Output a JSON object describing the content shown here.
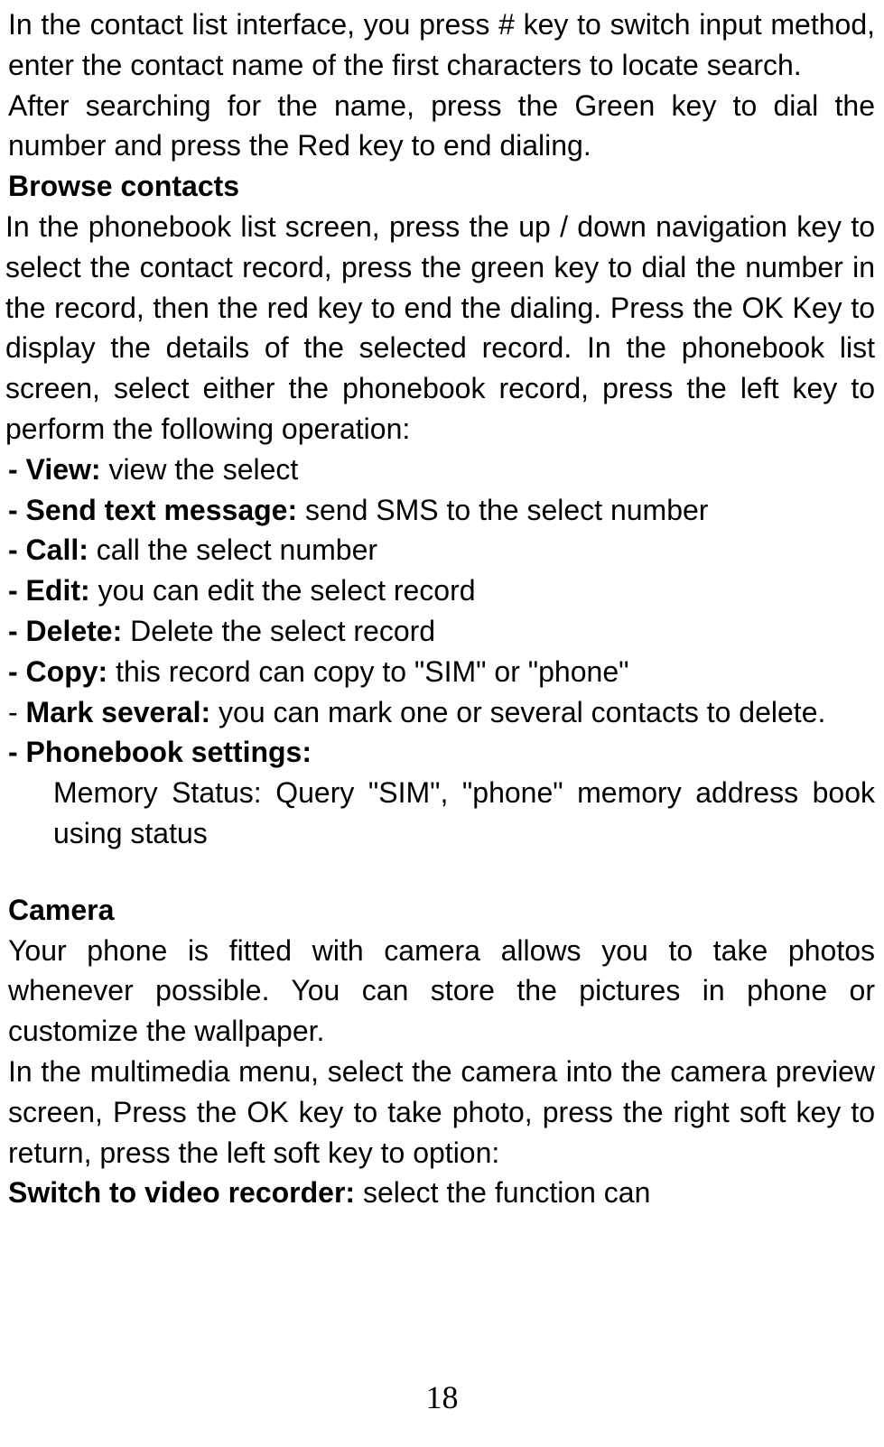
{
  "p1": "In the contact list interface, you press # key to switch input method, enter the contact name of the first characters to locate search.",
  "p2": "After searching for the name, press the Green key to dial the number and press the Red key to end dialing.",
  "h1": "Browse contacts",
  "p3": "In the phonebook list screen, press the up / down navigation key to select the contact record, press the green key to dial the number in the record, then the red key to end the dialing. Press the OK Key to display the details of the selected record. In the phonebook list screen, select either the phonebook record, press the left key to perform the following operation:",
  "item1_label": " - View: ",
  "item1_text": "view the select",
  "item2_label": "- Send text message: ",
  "item2_text": "send SMS to the select number",
  "item3_label": "- Call: ",
  "item3_text": "call the select number",
  "item4_label": "- Edit: ",
  "item4_text": "you can edit the select record",
  "item5_label": "- Delete: ",
  "item5_text": "Delete the select record",
  "item6_label": "- Copy: ",
  "item6_text": "this record can copy to \"SIM\" or \"phone\"",
  "item7_dash": "- ",
  "item7_label": "Mark several: ",
  "item7_text": "you can mark one or several contacts to delete.",
  "item8_label": "- Phonebook settings:",
  "item8_sub": "Memory Status: Query \"SIM\", \"phone\" memory address book using status",
  "h2": "Camera",
  "p4": "Your phone is fitted with camera allows you to take photos whenever possible. You can store the pictures in phone or customize the wallpaper.",
  "p5": "In the multimedia menu, select the camera into the camera preview screen, Press the OK key to take photo, press the right soft key to return, press the left soft key to option:",
  "item9_label": "Switch to video recorder: ",
  "item9_text": "select the function  can",
  "pageNumber": "18"
}
